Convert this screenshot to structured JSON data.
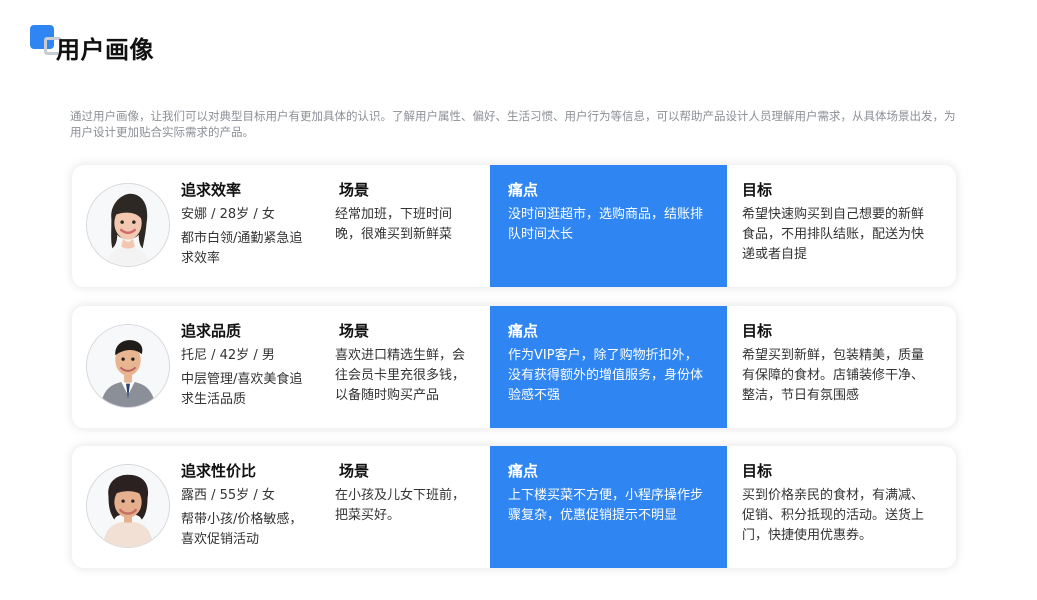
{
  "header": {
    "title": "用户画像",
    "intro": "通过用户画像，让我们可以对典型目标用户有更加具体的认识。了解用户属性、偏好、生活习惯、用户行为等信息，可以帮助产品设计人员理解用户需求，从具体场景出发，为用户设计更加贴合实际需求的产品。"
  },
  "theme": {
    "accent": "#2f86f2",
    "text": "#222222",
    "muted": "#8c8f96"
  },
  "personas": [
    {
      "avatar_icon": "female-young-avatar-icon",
      "title": "追求效率",
      "meta": "安娜 / 28岁 / 女",
      "desc": "都市白领/通勤紧急追求效率",
      "scene_title": "场景",
      "scene_text": "经常加班，下班时间晚，很难买到新鲜菜",
      "pain_title": "痛点",
      "pain_text": "没时间逛超市，选购商品，结账排队时间太长",
      "goal_title": "目标",
      "goal_text": "希望快速购买到自己想要的新鲜食品，不用排队结账，配送为快递或者自提"
    },
    {
      "avatar_icon": "male-avatar-icon",
      "title": "追求品质",
      "meta": "托尼 / 42岁 / 男",
      "desc": "中层管理/喜欢美食追求生活品质",
      "scene_title": "场景",
      "scene_text": "喜欢进口精选生鲜，会往会员卡里充很多钱，以备随时购买产品",
      "pain_title": "痛点",
      "pain_text": "作为VIP客户，除了购物折扣外，没有获得额外的增值服务，身份体验感不强",
      "goal_title": "目标",
      "goal_text": "希望买到新鲜，包装精美，质量有保障的食材。店铺装修干净、整洁，节日有氛围感"
    },
    {
      "avatar_icon": "female-senior-avatar-icon",
      "title": "追求性价比",
      "meta": "露西 / 55岁 / 女",
      "desc": "帮带小孩/价格敏感，喜欢促销活动",
      "scene_title": "场景",
      "scene_text": "在小孩及儿女下班前，把菜买好。",
      "pain_title": "痛点",
      "pain_text": "上下楼买菜不方便，小程序操作步骤复杂，优惠促销提示不明显",
      "goal_title": "目标",
      "goal_text": "买到价格亲民的食材，有满减、促销、积分抵现的活动。送货上门，快捷使用优惠券。"
    }
  ]
}
